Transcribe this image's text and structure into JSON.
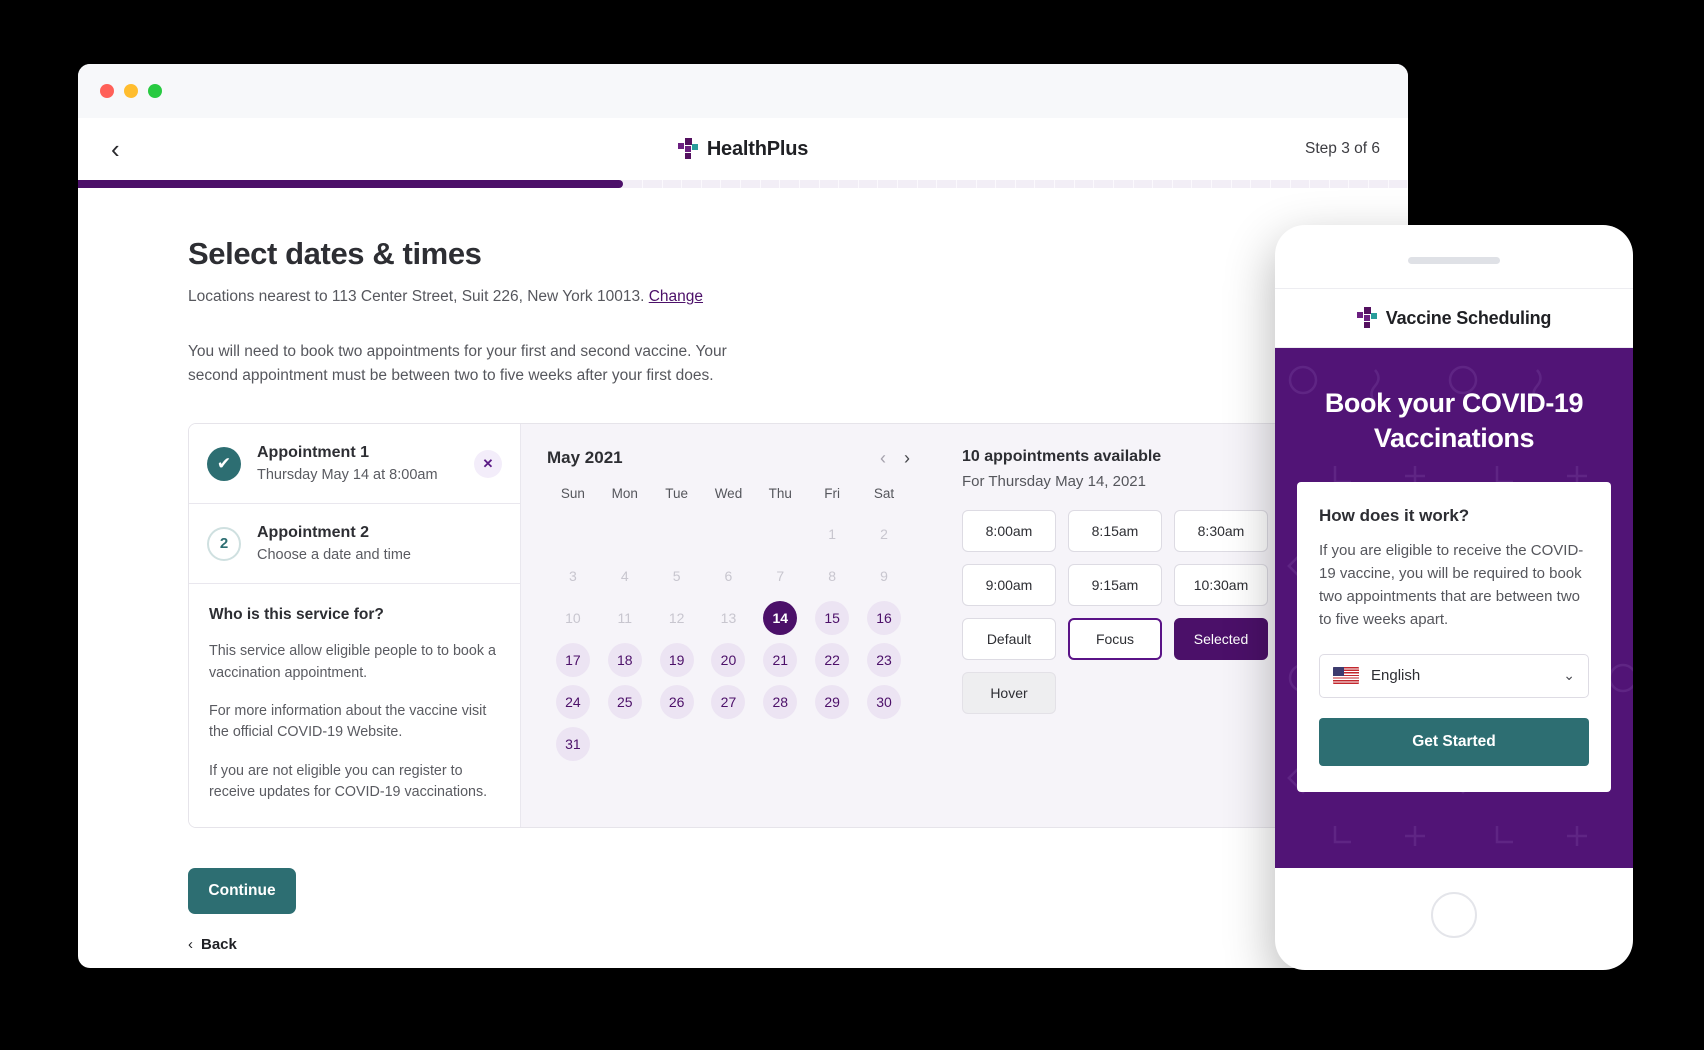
{
  "browser": {
    "traffic_lights": [
      "close",
      "minimize",
      "maximize"
    ]
  },
  "header": {
    "back_icon": "chevron-left-icon",
    "brand": "HealthPlus",
    "step": "Step 3 of 6",
    "progress_percent": 50
  },
  "main": {
    "title": "Select dates & times",
    "location_prefix": "Locations nearest to 113 Center Street, Suit 226, New York 10013.",
    "change_link": "Change",
    "intro": "You will need to book two appointments for your first and second vaccine. Your second appointment must be between two to five weeks after your first does."
  },
  "appointments": [
    {
      "state": "done",
      "marker": "✔",
      "title": "Appointment 1",
      "subtitle": "Thursday May 14 at 8:00am",
      "remove_icon": "✕"
    },
    {
      "state": "pending",
      "marker": "2",
      "title": "Appointment 2",
      "subtitle": "Choose a date and time"
    }
  ],
  "who": {
    "heading": "Who is this service for?",
    "paragraphs": [
      "This service allow eligible people to to book a vaccination appointment.",
      "For more information about the vaccine visit the official COVID-19 Website.",
      "If you are not eligible you can register to receive updates for COVID-19 vaccinations."
    ]
  },
  "calendar": {
    "month": "May 2021",
    "prev_icon": "‹",
    "next_icon": "›",
    "weekdays": [
      "Sun",
      "Mon",
      "Tue",
      "Wed",
      "Thu",
      "Fri",
      "Sat"
    ],
    "weeks": [
      [
        {
          "d": "",
          "s": "empty"
        },
        {
          "d": "",
          "s": "empty"
        },
        {
          "d": "",
          "s": "empty"
        },
        {
          "d": "",
          "s": "empty"
        },
        {
          "d": "",
          "s": "empty"
        },
        {
          "d": "1",
          "s": "past"
        },
        {
          "d": "2",
          "s": "past"
        }
      ],
      [
        {
          "d": "3",
          "s": "past"
        },
        {
          "d": "4",
          "s": "past"
        },
        {
          "d": "5",
          "s": "past"
        },
        {
          "d": "6",
          "s": "past"
        },
        {
          "d": "7",
          "s": "past"
        },
        {
          "d": "8",
          "s": "past"
        },
        {
          "d": "9",
          "s": "past"
        }
      ],
      [
        {
          "d": "10",
          "s": "past"
        },
        {
          "d": "11",
          "s": "past"
        },
        {
          "d": "12",
          "s": "past"
        },
        {
          "d": "13",
          "s": "past"
        },
        {
          "d": "14",
          "s": "sel"
        },
        {
          "d": "15",
          "s": "avail"
        },
        {
          "d": "16",
          "s": "avail"
        }
      ],
      [
        {
          "d": "17",
          "s": "avail"
        },
        {
          "d": "18",
          "s": "avail"
        },
        {
          "d": "19",
          "s": "avail"
        },
        {
          "d": "20",
          "s": "avail"
        },
        {
          "d": "21",
          "s": "avail"
        },
        {
          "d": "22",
          "s": "avail"
        },
        {
          "d": "23",
          "s": "avail"
        }
      ],
      [
        {
          "d": "24",
          "s": "avail"
        },
        {
          "d": "25",
          "s": "avail"
        },
        {
          "d": "26",
          "s": "avail"
        },
        {
          "d": "27",
          "s": "avail"
        },
        {
          "d": "28",
          "s": "avail"
        },
        {
          "d": "29",
          "s": "avail"
        },
        {
          "d": "30",
          "s": "avail"
        }
      ],
      [
        {
          "d": "31",
          "s": "avail"
        },
        {
          "d": "",
          "s": "empty"
        },
        {
          "d": "",
          "s": "empty"
        },
        {
          "d": "",
          "s": "empty"
        },
        {
          "d": "",
          "s": "empty"
        },
        {
          "d": "",
          "s": "empty"
        },
        {
          "d": "",
          "s": "empty"
        }
      ]
    ]
  },
  "slots": {
    "heading": "10 appointments available",
    "for_day": "For Thursday May 14, 2021",
    "items": [
      {
        "label": "8:00am",
        "state": "default"
      },
      {
        "label": "8:15am",
        "state": "default"
      },
      {
        "label": "8:30am",
        "state": "default"
      },
      {
        "label": "9:00am",
        "state": "default"
      },
      {
        "label": "9:15am",
        "state": "default"
      },
      {
        "label": "10:30am",
        "state": "default"
      },
      {
        "label": "Default",
        "state": "default"
      },
      {
        "label": "Focus",
        "state": "focus"
      },
      {
        "label": "Selected",
        "state": "selected"
      },
      {
        "label": "Hover",
        "state": "hover"
      }
    ]
  },
  "footer": {
    "continue_label": "Continue",
    "back_label": "Back",
    "back_chevron": "‹"
  },
  "phone": {
    "brand": "Vaccine Scheduling",
    "hero_title": "Book your COVID-19 Vaccinations",
    "card": {
      "heading": "How does it work?",
      "body": "If you are eligible to receive the COVID-19 vaccine, you will be required to book two appointments that are between two to five weeks apart.",
      "language": "English",
      "language_chevron": "⌄",
      "flag": "us-flag-icon",
      "cta": "Get Started"
    }
  },
  "colors": {
    "purple": "#4c1069",
    "purple_hero": "#511476",
    "teal": "#2d6e72",
    "logo_teal": "#2a9d9b",
    "light_purple": "#ece4f3"
  }
}
